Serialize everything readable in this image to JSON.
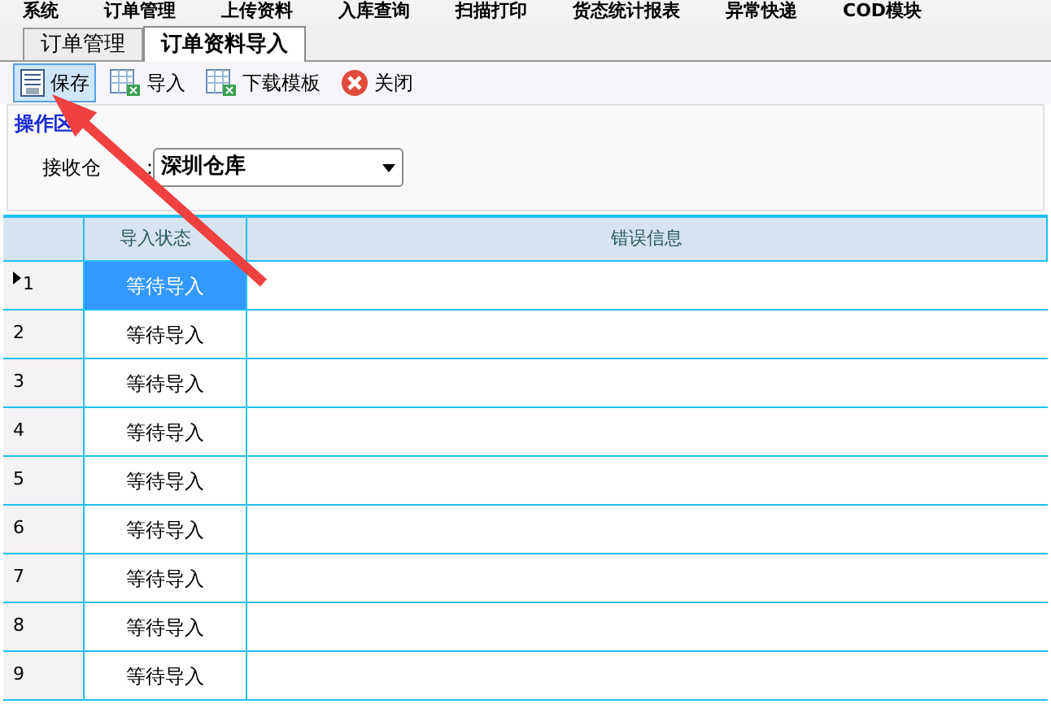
{
  "menu": [
    "系统",
    "订单管理",
    "上传资料",
    "入库查询",
    "扫描打印",
    "货态统计报表",
    "异常快递",
    "COD模块"
  ],
  "tabs": [
    {
      "label": "订单管理",
      "selected": false
    },
    {
      "label": "订单资料导入",
      "selected": true
    }
  ],
  "toolbar": [
    {
      "label": "保存",
      "kind": "save",
      "selected": true
    },
    {
      "label": "导入",
      "kind": "import",
      "selected": false
    },
    {
      "label": "下载模板",
      "kind": "import",
      "selected": false
    },
    {
      "label": "关闭",
      "kind": "close",
      "selected": false
    }
  ],
  "group": {
    "title": "操作区",
    "field_label": "接收仓",
    "field_suffix": ":",
    "value": "深圳仓库"
  },
  "table": {
    "columns": [
      "",
      "导入状态",
      "错误信息"
    ],
    "rows": [
      {
        "index": "1",
        "status": "等待导入",
        "selected": true
      },
      {
        "index": "2",
        "status": "等待导入",
        "selected": false
      },
      {
        "index": "3",
        "status": "等待导入",
        "selected": false
      },
      {
        "index": "4",
        "status": "等待导入",
        "selected": false
      },
      {
        "index": "5",
        "status": "等待导入",
        "selected": false
      },
      {
        "index": "6",
        "status": "等待导入",
        "selected": false
      },
      {
        "index": "7",
        "status": "等待导入",
        "selected": false
      },
      {
        "index": "8",
        "status": "等待导入",
        "selected": false
      },
      {
        "index": "9",
        "status": "等待导入",
        "selected": false
      }
    ]
  }
}
